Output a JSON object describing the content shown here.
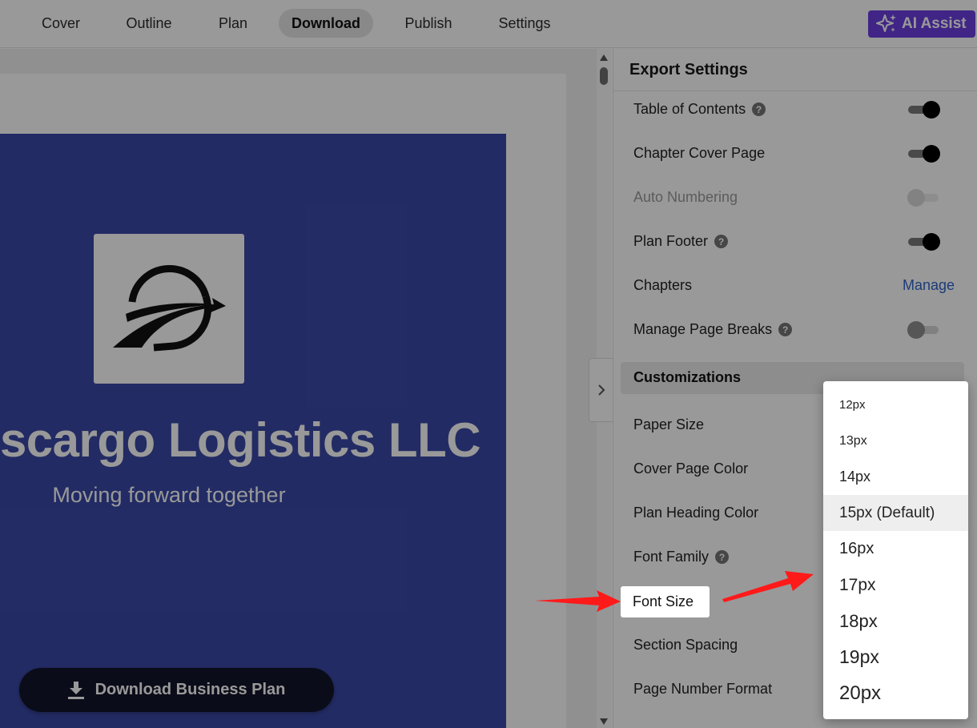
{
  "nav": {
    "tabs": [
      {
        "label": "Cover"
      },
      {
        "label": "Outline"
      },
      {
        "label": "Plan"
      },
      {
        "label": "Download"
      },
      {
        "label": "Publish"
      },
      {
        "label": "Settings"
      }
    ],
    "active_tab": "Download",
    "ai_assist": "AI Assist"
  },
  "cover": {
    "company_name": "scargo Logistics LLC",
    "tagline": "Moving forward together",
    "download_button": "Download Business Plan"
  },
  "export_settings": {
    "title": "Export Settings",
    "rows": [
      {
        "label": "Table of Contents",
        "help": "?",
        "toggle": "on"
      },
      {
        "label": "Chapter Cover Page",
        "toggle": "on"
      },
      {
        "label": "Auto Numbering",
        "toggle": "disabled"
      },
      {
        "label": "Plan Footer",
        "help": "?",
        "toggle": "on"
      },
      {
        "label": "Chapters",
        "link": "Manage"
      },
      {
        "label": "Manage Page Breaks",
        "help": "?",
        "toggle": "off"
      }
    ]
  },
  "customizations": {
    "title": "Customizations",
    "rows": [
      {
        "label": "Paper Size"
      },
      {
        "label": "Cover Page Color"
      },
      {
        "label": "Plan Heading Color"
      },
      {
        "label": "Font Family",
        "help": "?"
      },
      {
        "label": "Font Size"
      },
      {
        "label": "Section Spacing"
      },
      {
        "label": "Page Number Format"
      }
    ]
  },
  "font_size_dropdown": {
    "options": [
      "12px",
      "13px",
      "14px",
      "15px (Default)",
      "16px",
      "17px",
      "18px",
      "19px",
      "20px"
    ],
    "highlighted": "15px (Default)"
  },
  "colors": {
    "accent_purple": "#6b3fdf",
    "cover_blue": "#3a49a7",
    "link_blue": "#2f64c9",
    "annotation_red": "#ff1a1a"
  },
  "icons": {
    "ai_assist": "sparkle-icon",
    "download": "download-icon",
    "help": "help-circle-icon",
    "collapse": "chevron-right-icon"
  }
}
